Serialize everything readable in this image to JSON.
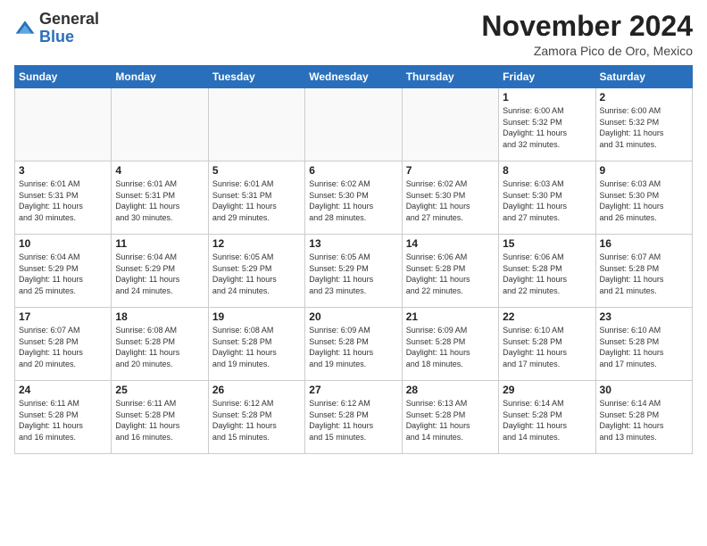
{
  "logo": {
    "general": "General",
    "blue": "Blue"
  },
  "title": "November 2024",
  "location": "Zamora Pico de Oro, Mexico",
  "weekdays": [
    "Sunday",
    "Monday",
    "Tuesday",
    "Wednesday",
    "Thursday",
    "Friday",
    "Saturday"
  ],
  "weeks": [
    [
      {
        "day": "",
        "info": ""
      },
      {
        "day": "",
        "info": ""
      },
      {
        "day": "",
        "info": ""
      },
      {
        "day": "",
        "info": ""
      },
      {
        "day": "",
        "info": ""
      },
      {
        "day": "1",
        "info": "Sunrise: 6:00 AM\nSunset: 5:32 PM\nDaylight: 11 hours\nand 32 minutes."
      },
      {
        "day": "2",
        "info": "Sunrise: 6:00 AM\nSunset: 5:32 PM\nDaylight: 11 hours\nand 31 minutes."
      }
    ],
    [
      {
        "day": "3",
        "info": "Sunrise: 6:01 AM\nSunset: 5:31 PM\nDaylight: 11 hours\nand 30 minutes."
      },
      {
        "day": "4",
        "info": "Sunrise: 6:01 AM\nSunset: 5:31 PM\nDaylight: 11 hours\nand 30 minutes."
      },
      {
        "day": "5",
        "info": "Sunrise: 6:01 AM\nSunset: 5:31 PM\nDaylight: 11 hours\nand 29 minutes."
      },
      {
        "day": "6",
        "info": "Sunrise: 6:02 AM\nSunset: 5:30 PM\nDaylight: 11 hours\nand 28 minutes."
      },
      {
        "day": "7",
        "info": "Sunrise: 6:02 AM\nSunset: 5:30 PM\nDaylight: 11 hours\nand 27 minutes."
      },
      {
        "day": "8",
        "info": "Sunrise: 6:03 AM\nSunset: 5:30 PM\nDaylight: 11 hours\nand 27 minutes."
      },
      {
        "day": "9",
        "info": "Sunrise: 6:03 AM\nSunset: 5:30 PM\nDaylight: 11 hours\nand 26 minutes."
      }
    ],
    [
      {
        "day": "10",
        "info": "Sunrise: 6:04 AM\nSunset: 5:29 PM\nDaylight: 11 hours\nand 25 minutes."
      },
      {
        "day": "11",
        "info": "Sunrise: 6:04 AM\nSunset: 5:29 PM\nDaylight: 11 hours\nand 24 minutes."
      },
      {
        "day": "12",
        "info": "Sunrise: 6:05 AM\nSunset: 5:29 PM\nDaylight: 11 hours\nand 24 minutes."
      },
      {
        "day": "13",
        "info": "Sunrise: 6:05 AM\nSunset: 5:29 PM\nDaylight: 11 hours\nand 23 minutes."
      },
      {
        "day": "14",
        "info": "Sunrise: 6:06 AM\nSunset: 5:28 PM\nDaylight: 11 hours\nand 22 minutes."
      },
      {
        "day": "15",
        "info": "Sunrise: 6:06 AM\nSunset: 5:28 PM\nDaylight: 11 hours\nand 22 minutes."
      },
      {
        "day": "16",
        "info": "Sunrise: 6:07 AM\nSunset: 5:28 PM\nDaylight: 11 hours\nand 21 minutes."
      }
    ],
    [
      {
        "day": "17",
        "info": "Sunrise: 6:07 AM\nSunset: 5:28 PM\nDaylight: 11 hours\nand 20 minutes."
      },
      {
        "day": "18",
        "info": "Sunrise: 6:08 AM\nSunset: 5:28 PM\nDaylight: 11 hours\nand 20 minutes."
      },
      {
        "day": "19",
        "info": "Sunrise: 6:08 AM\nSunset: 5:28 PM\nDaylight: 11 hours\nand 19 minutes."
      },
      {
        "day": "20",
        "info": "Sunrise: 6:09 AM\nSunset: 5:28 PM\nDaylight: 11 hours\nand 19 minutes."
      },
      {
        "day": "21",
        "info": "Sunrise: 6:09 AM\nSunset: 5:28 PM\nDaylight: 11 hours\nand 18 minutes."
      },
      {
        "day": "22",
        "info": "Sunrise: 6:10 AM\nSunset: 5:28 PM\nDaylight: 11 hours\nand 17 minutes."
      },
      {
        "day": "23",
        "info": "Sunrise: 6:10 AM\nSunset: 5:28 PM\nDaylight: 11 hours\nand 17 minutes."
      }
    ],
    [
      {
        "day": "24",
        "info": "Sunrise: 6:11 AM\nSunset: 5:28 PM\nDaylight: 11 hours\nand 16 minutes."
      },
      {
        "day": "25",
        "info": "Sunrise: 6:11 AM\nSunset: 5:28 PM\nDaylight: 11 hours\nand 16 minutes."
      },
      {
        "day": "26",
        "info": "Sunrise: 6:12 AM\nSunset: 5:28 PM\nDaylight: 11 hours\nand 15 minutes."
      },
      {
        "day": "27",
        "info": "Sunrise: 6:12 AM\nSunset: 5:28 PM\nDaylight: 11 hours\nand 15 minutes."
      },
      {
        "day": "28",
        "info": "Sunrise: 6:13 AM\nSunset: 5:28 PM\nDaylight: 11 hours\nand 14 minutes."
      },
      {
        "day": "29",
        "info": "Sunrise: 6:14 AM\nSunset: 5:28 PM\nDaylight: 11 hours\nand 14 minutes."
      },
      {
        "day": "30",
        "info": "Sunrise: 6:14 AM\nSunset: 5:28 PM\nDaylight: 11 hours\nand 13 minutes."
      }
    ]
  ]
}
